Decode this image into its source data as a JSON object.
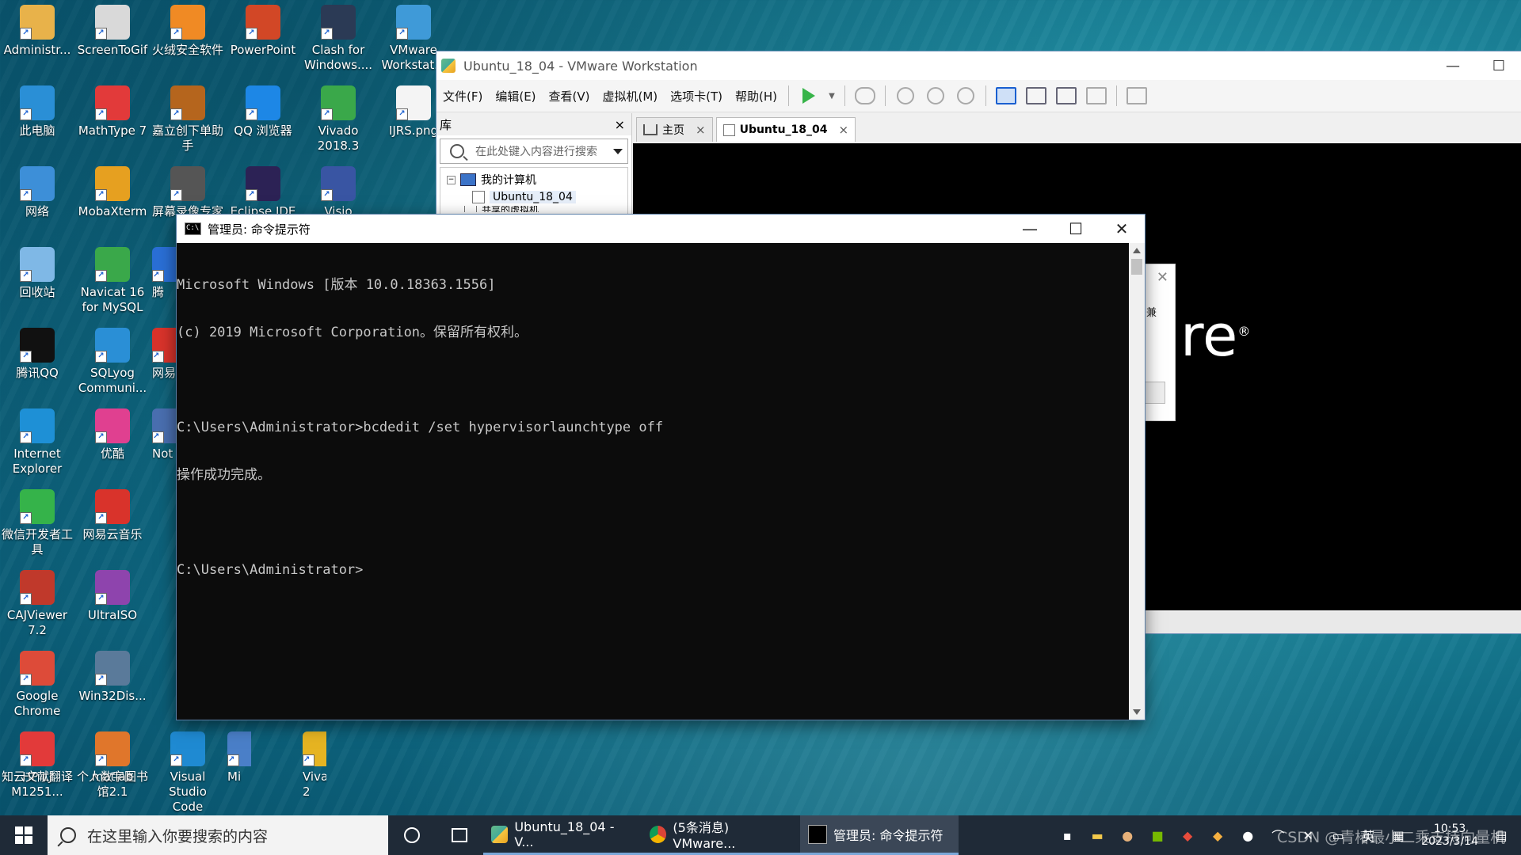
{
  "desktop": {
    "icons": [
      {
        "label": "Administr...",
        "icon": "user-folder-icon",
        "color": "#e8b24a"
      },
      {
        "label": "ScreenToGif",
        "icon": "screentogif-icon",
        "color": "#d9d9d9"
      },
      {
        "label": "火绒安全软件",
        "icon": "huorong-icon",
        "color": "#f08a24"
      },
      {
        "label": "PowerPoint",
        "icon": "powerpoint-icon",
        "color": "#d24726"
      },
      {
        "label": "Clash for Windows....",
        "icon": "clash-icon",
        "color": "#2b3a55"
      },
      {
        "label": "VMware Workstat...",
        "icon": "vmware-icon",
        "color": "#3f9ad8"
      },
      {
        "label": "此电脑",
        "icon": "this-pc-icon",
        "color": "#2a8fd6"
      },
      {
        "label": "MathType 7",
        "icon": "mathtype-icon",
        "color": "#e23a3a"
      },
      {
        "label": "嘉立创下单助手",
        "icon": "jlc-icon",
        "color": "#b5651d"
      },
      {
        "label": "QQ 浏览器",
        "icon": "qq-browser-icon",
        "color": "#1d87e6"
      },
      {
        "label": "Vivado 2018.3",
        "icon": "vivado-icon",
        "color": "#3aa84a"
      },
      {
        "label": "IJRS.png",
        "icon": "image-file-icon",
        "color": "#f4f4f4"
      },
      {
        "label": "网络",
        "icon": "network-icon",
        "color": "#3d8fd8"
      },
      {
        "label": "MobaXterm",
        "icon": "mobaxterm-icon",
        "color": "#e6a020"
      },
      {
        "label": "屏幕录像专家",
        "icon": "screen-recorder-icon",
        "color": "#555555"
      },
      {
        "label": "Eclipse IDE",
        "icon": "eclipse-icon",
        "color": "#2c2255"
      },
      {
        "label": "Visio",
        "icon": "visio-icon",
        "color": "#3955a3"
      },
      {
        "label": "回收站",
        "icon": "recycle-bin-icon",
        "color": "#7fb8e6"
      },
      {
        "label": "Navicat 16 for MySQL",
        "icon": "navicat-icon",
        "color": "#3aa84a"
      },
      {
        "label": "腾讯QQ",
        "icon": "qq-icon",
        "color": "#111111"
      },
      {
        "label": "SQLyog Communi...",
        "icon": "sqlyog-icon",
        "color": "#2a8fd6"
      },
      {
        "label": "Internet Explorer",
        "icon": "ie-icon",
        "color": "#1e90d6"
      },
      {
        "label": "优酷",
        "icon": "youku-icon",
        "color": "#e04090"
      },
      {
        "label": "微信开发者工具",
        "icon": "wechat-devtools-icon",
        "color": "#35b34a"
      },
      {
        "label": "网易云音乐",
        "icon": "netease-music-icon",
        "color": "#d9332b"
      },
      {
        "label": "CAJViewer 7.2",
        "icon": "cajviewer-icon",
        "color": "#c0392b"
      },
      {
        "label": "UltraISO",
        "icon": "ultraiso-icon",
        "color": "#8e44ad"
      },
      {
        "label": "Google Chrome",
        "icon": "chrome-icon",
        "color": "#dd4b39"
      },
      {
        "label": "Win32Dis...",
        "icon": "win32diskimager-icon",
        "color": "#5a7a9a"
      },
      {
        "label": "HP LJ M1251...",
        "icon": "printer-icon",
        "color": "#5a6b7d"
      },
      {
        "label": "个人数字图书馆2.1",
        "icon": "digital-library-icon",
        "color": "#2a5fa8"
      },
      {
        "label": "知云文献翻译",
        "icon": "zhiyun-icon",
        "color": "#e23a3a"
      },
      {
        "label": "matlab",
        "icon": "matlab-icon",
        "color": "#e0762b"
      },
      {
        "label": "Visual Studio Code",
        "icon": "vscode-icon",
        "color": "#1f8ad2"
      },
      {
        "label": "Mi",
        "icon": "partial-icon",
        "color": "#4a7fc8"
      },
      {
        "label": "Viva 2",
        "icon": "partial-icon",
        "color": "#e6b422"
      },
      {
        "label": "腾",
        "icon": "partial-icon",
        "color": "#2a6fd6"
      },
      {
        "label": "网易",
        "icon": "partial-icon",
        "color": "#d9332b"
      },
      {
        "label": "Not",
        "icon": "partial-icon",
        "color": "#4a6fb0"
      }
    ]
  },
  "vmware": {
    "title": "Ubuntu_18_04 - VMware Workstation",
    "menu": [
      "文件(F)",
      "编辑(E)",
      "查看(V)",
      "虚拟机(M)",
      "选项卡(T)",
      "帮助(H)"
    ],
    "library": {
      "title": "库",
      "close": "×",
      "search_placeholder": "在此处键入内容进行搜索",
      "tree": {
        "root": "我的计算机",
        "child": "Ubuntu_18_04",
        "partial": "共享的虚拟机"
      }
    },
    "tabs": [
      {
        "label": "主页",
        "close": "×"
      },
      {
        "label": "Ubuntu_18_04",
        "close": "×"
      }
    ],
    "logo_text": "re",
    "popup_text": "兼"
  },
  "cmd": {
    "title": "管理员: 命令提示符",
    "icon_text": "C:\\",
    "lines": [
      "Microsoft Windows [版本 10.0.18363.1556]",
      "(c) 2019 Microsoft Corporation。保留所有权利。",
      "",
      "C:\\Users\\Administrator>bcdedit /set hypervisorlaunchtype off",
      "操作成功完成。",
      "",
      "C:\\Users\\Administrator>"
    ]
  },
  "taskbar": {
    "search_placeholder": "在这里输入你要搜索的内容",
    "items": [
      {
        "label": "Ubuntu_18_04 - V...",
        "icon": "vmware-icon"
      },
      {
        "label": "(5条消息) VMware...",
        "icon": "chrome-icon"
      },
      {
        "label": "管理员: 命令提示符",
        "icon": "cmd-icon"
      }
    ],
    "ime": "英",
    "clock_time": "10:53",
    "clock_date": "2023/3/14",
    "watermark": "CSDN @青椿最小二乘支持向量机"
  }
}
